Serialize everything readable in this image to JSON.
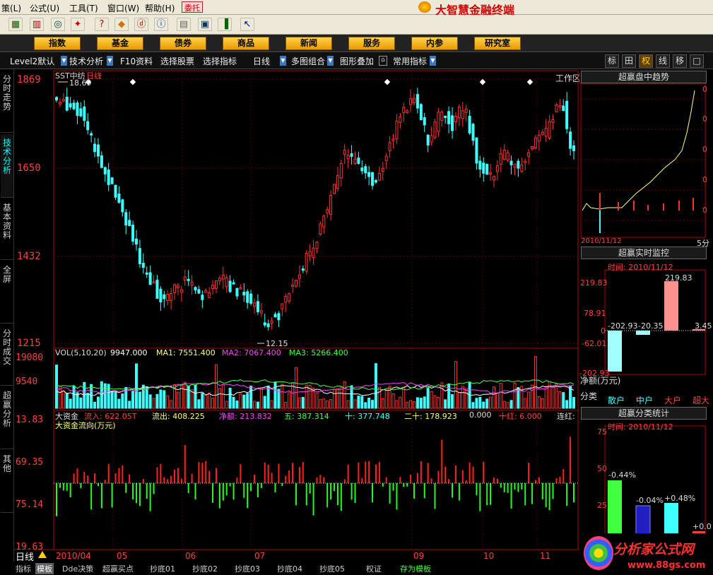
{
  "menubar": {
    "items": [
      "策(L)",
      "公式(U)",
      "工具(T)",
      "窗口(W)",
      "帮助(H)"
    ],
    "entrust": "委托",
    "brand": "大智慧金融终端"
  },
  "nav": {
    "items": [
      "指数",
      "基金",
      "债券",
      "商品",
      "新闻",
      "服务",
      "内参",
      "研究室"
    ],
    "workarea": "工作区"
  },
  "tabs": {
    "items": [
      "Level2默认",
      "技术分析",
      "F10资料",
      "选择股票",
      "选择指标",
      "日线",
      "多图组合",
      "图形叠加",
      "常用指标"
    ],
    "right_buttons": [
      "标",
      "田",
      "权",
      "线",
      "移",
      "□"
    ]
  },
  "leftbar": {
    "items": [
      "分时走势",
      "技术分析",
      "基本资料",
      "全屏",
      "分时成交",
      "超赢分析",
      "其他"
    ]
  },
  "price_chart": {
    "title": "SST中纺",
    "period": "日线",
    "yticks": [
      "1869",
      "1650",
      "1432",
      "1215"
    ],
    "high_label": "18.69",
    "low_label": "12.15"
  },
  "volume_chart": {
    "name": "VOL(5,10,20)",
    "value": "9947.000",
    "ma1": "MA1: 7551.400",
    "ma2": "MA2: 7067.400",
    "ma3": "MA3: 5266.400",
    "yticks": [
      "19080",
      "9540"
    ]
  },
  "fund_chart": {
    "name": "大资金",
    "inflow": "流入: 622.05T",
    "outflow": "流出: 408.225",
    "net": "净额: 213.832",
    "five": "五: 387.314",
    "ten": "十: 377.748",
    "twenty": "二十: 178.923",
    "zero": "0.000",
    "red": "十红: 6.000",
    "cont": "连红:",
    "subtitle": "大资金流向(万元)",
    "yticks": [
      "13.83",
      "69.35",
      "75.14",
      "19.63"
    ]
  },
  "xaxis": {
    "labels": [
      "2010/04",
      "05",
      "06",
      "07",
      "09",
      "10",
      "11"
    ],
    "period_label": "日线"
  },
  "bottom_tabs": [
    "指标",
    "模板",
    "Dde决策",
    "超赢买点",
    "抄底01",
    "抄底02",
    "抄底03",
    "抄底04",
    "抄底05",
    "权证",
    "存为模板"
  ],
  "right": {
    "trend": {
      "title": "超赢盘中趋势",
      "ylabels": [
        "0",
        "0",
        "0",
        "0",
        "0"
      ],
      "date": "2010/11/12",
      "unit": "5分"
    },
    "monitor": {
      "title": "超赢实时监控",
      "time_label": "时间: 2010/11/12",
      "yticks": [
        "219.83",
        "78.91",
        "0",
        "-62.01",
        "-202.93"
      ],
      "values": {
        "small": "-202.93",
        "mid": "-20.35",
        "big": "219.83",
        "super": "3.45"
      },
      "net_label": "净额(万元)",
      "category_label": "分类",
      "categories": [
        "散户",
        "中户",
        "大户",
        "超大"
      ]
    },
    "classify": {
      "title": "超赢分类统计",
      "time_label": "时间: 2010/11/12",
      "yticks": [
        "75",
        "50",
        "25"
      ],
      "values": [
        "-0.44%",
        "-0.04%",
        "+0.48%",
        "+0.0"
      ]
    }
  },
  "watermark": {
    "text": "分析家公式网",
    "url": "www.88gs.com"
  }
}
